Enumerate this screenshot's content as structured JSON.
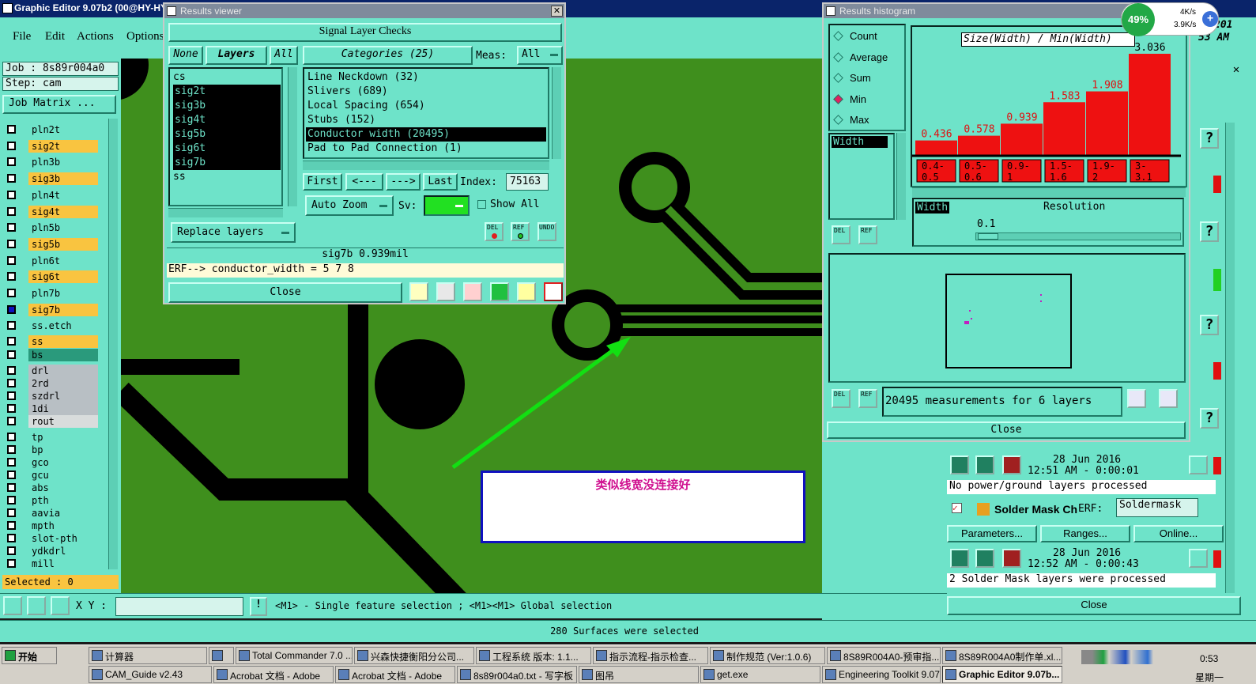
{
  "app": {
    "title": "Graphic Editor 9.07b2 (00@HY-HY"
  },
  "menu": [
    "File",
    "Edit",
    "Actions",
    "Options"
  ],
  "left": {
    "job": "Job : 8s89r004a0",
    "step": "Step: cam",
    "job_matrix": "Job Matrix ...",
    "selected": "Selected : 0"
  },
  "layers": [
    {
      "name": "pln2t",
      "color": "#6ee3c9"
    },
    {
      "name": "sig2t",
      "color": "#f9c440"
    },
    {
      "name": "pln3b",
      "color": "#6ee3c9"
    },
    {
      "name": "sig3b",
      "color": "#f9c440"
    },
    {
      "name": "pln4t",
      "color": "#6ee3c9"
    },
    {
      "name": "sig4t",
      "color": "#f9c440"
    },
    {
      "name": "pln5b",
      "color": "#6ee3c9"
    },
    {
      "name": "sig5b",
      "color": "#f9c440"
    },
    {
      "name": "pln6t",
      "color": "#6ee3c9"
    },
    {
      "name": "sig6t",
      "color": "#f9c440"
    },
    {
      "name": "pln7b",
      "color": "#6ee3c9"
    },
    {
      "name": "sig7b",
      "color": "#f9c440"
    },
    {
      "name": "ss.etch",
      "color": "#6ee3c9"
    },
    {
      "name": "ss",
      "color": "#f9c440"
    },
    {
      "name": "bs",
      "color": "#2a9a7c"
    },
    {
      "name": "drl",
      "color": "#b8bfc4"
    },
    {
      "name": "2rd",
      "color": "#b8bfc4"
    },
    {
      "name": "szdrl",
      "color": "#b8bfc4"
    },
    {
      "name": "1di",
      "color": "#b8bfc4"
    },
    {
      "name": "rout",
      "color": "#d8dcdc"
    },
    {
      "name": "tp",
      "color": "#6ee3c9"
    },
    {
      "name": "bp",
      "color": "#6ee3c9"
    },
    {
      "name": "gco",
      "color": "#6ee3c9"
    },
    {
      "name": "gcu",
      "color": "#6ee3c9"
    },
    {
      "name": "abs",
      "color": "#6ee3c9"
    },
    {
      "name": "pth",
      "color": "#6ee3c9"
    },
    {
      "name": "aavia",
      "color": "#6ee3c9"
    },
    {
      "name": "mpth",
      "color": "#6ee3c9"
    },
    {
      "name": "slot-pth",
      "color": "#6ee3c9"
    },
    {
      "name": "ydkdrl",
      "color": "#6ee3c9"
    },
    {
      "name": "mill",
      "color": "#6ee3c9"
    }
  ],
  "results_viewer": {
    "title": "Results viewer",
    "heading": "Signal Layer Checks",
    "none": "None",
    "layers_tab": "Layers",
    "all": "All",
    "categories": "Categories (25)",
    "meas_label": "Meas:",
    "meas_value": "All",
    "layer_list": [
      "cs",
      "sig2t",
      "sig3b",
      "sig4t",
      "sig5b",
      "sig6t",
      "sig7b",
      "ss"
    ],
    "category_list": [
      "Line Neckdown (32)",
      "Slivers (689)",
      "Local Spacing (654)",
      "Stubs (152)",
      "Conductor width (20495)",
      "Pad to Pad Connection (1)"
    ],
    "first": "First",
    "prev": "<---",
    "next": "--->",
    "last": "Last",
    "index_label": "Index:",
    "index_value": "75163",
    "auto_zoom": "Auto Zoom",
    "sv_label": "Sv:",
    "show_all": "Show All",
    "replace_layers": "Replace layers",
    "del": "DEL",
    "ref": "REF",
    "undo": "UNDO",
    "status": "sig7b 0.939mil",
    "erf": "ERF--> conductor_width = 5 7 8",
    "close": "Close"
  },
  "histogram": {
    "title": "Results histogram",
    "options": [
      "Count",
      "Average",
      "Sum",
      "Min",
      "Max"
    ],
    "selected_option": "Min",
    "field": "Width",
    "caption": "Size(Width) / Min(Width)",
    "resolution_label": "Resolution",
    "resolution_field": "Width",
    "resolution_value": "0.1",
    "del": "DEL",
    "ref": "REF",
    "summary": "20495 measurements for 6 layers",
    "close": "Close"
  },
  "chart_data": {
    "type": "bar",
    "title": "Size(Width) / Min(Width)",
    "categories": [
      "0.4-0.5",
      "0.5-0.6",
      "0.9-1",
      "1.5-1.6",
      "1.9-2",
      "3-3.1"
    ],
    "values": [
      0.436,
      0.578,
      0.939,
      1.583,
      1.908,
      3.036
    ],
    "bar_color": "#ee1111"
  },
  "right_panel": {
    "date1": "28 Jun 2016",
    "time1": "12:51 AM - 0:00:01",
    "msg1": "No power/ground layers processed",
    "solder_name": "Solder Mask Ch",
    "erf_label": "ERF:",
    "erf_value": "Soldermask",
    "parameters": "Parameters...",
    "ranges": "Ranges...",
    "online": "Online...",
    "date2": "28 Jun 2016",
    "time2": "12:52 AM - 0:00:43",
    "msg2": "2 Solder Mask layers were processed",
    "close": "Close",
    "partial_top": "201",
    "partial_am": "53 AM"
  },
  "net": {
    "percent": "49%",
    "up": "4K/s",
    "down": "3.9K/s"
  },
  "canvas": {
    "annotation": "类似线宽没连接好"
  },
  "bottom": {
    "xy_label": "X Y :",
    "hint": "<M1> - Single feature selection ; <M1><M1> Global selection",
    "status": "280 Surfaces were selected"
  },
  "taskbar": {
    "start": "开始",
    "row1": [
      "计算器",
      "",
      "Total Commander 7.0 ...",
      "兴森快捷衡阳分公司...",
      "工程系统  版本: 1.1...",
      "指示流程-指示检查...",
      "制作规范 (Ver:1.0.6)",
      "8S89R004A0-预审指...",
      "8S89R004A0制作单.xl..."
    ],
    "row2": [
      "CAM_Guide v2.43",
      "Acrobat 文档 - Adobe",
      "Acrobat 文档 - Adobe",
      "8s89r004a0.txt - 写字板",
      "图吊",
      "get.exe",
      "Engineering Toolkit 9.07",
      "Graphic Editor 9.07b..."
    ],
    "clock": "0:53",
    "weekday": "星期一"
  }
}
